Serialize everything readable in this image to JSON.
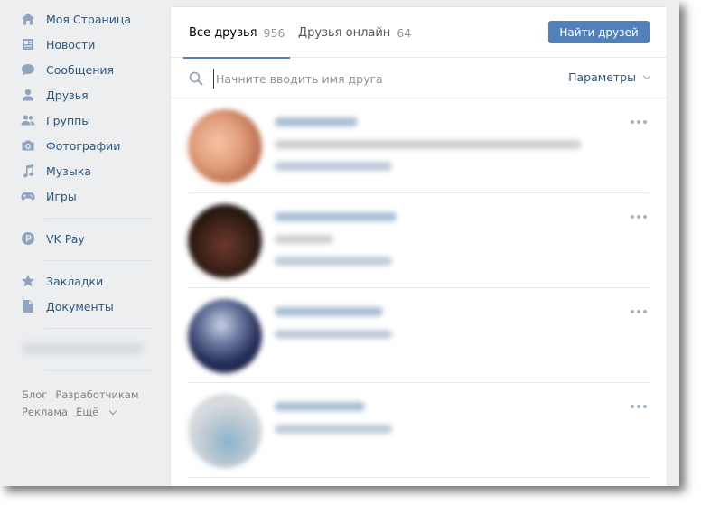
{
  "sidebar": {
    "items": [
      {
        "label": "Моя Страница",
        "icon": "home-icon"
      },
      {
        "label": "Новости",
        "icon": "news-icon"
      },
      {
        "label": "Сообщения",
        "icon": "messages-icon"
      },
      {
        "label": "Друзья",
        "icon": "friends-icon"
      },
      {
        "label": "Группы",
        "icon": "groups-icon"
      },
      {
        "label": "Фотографии",
        "icon": "camera-icon"
      },
      {
        "label": "Музыка",
        "icon": "music-note-icon"
      },
      {
        "label": "Игры",
        "icon": "gamepad-icon"
      },
      {
        "label": "VK Pay",
        "icon": "vkpay-icon"
      },
      {
        "label": "Закладки",
        "icon": "star-icon"
      },
      {
        "label": "Документы",
        "icon": "document-icon"
      }
    ],
    "footer": {
      "blog": "Блог",
      "developers": "Разработчикам",
      "ads": "Реклама",
      "more": "Ещё"
    }
  },
  "tabs": [
    {
      "label": "Все друзья",
      "count": "956",
      "active": true
    },
    {
      "label": "Друзья онлайн",
      "count": "64",
      "active": false
    }
  ],
  "find_friends_label": "Найти друзей",
  "search": {
    "placeholder": "Начните вводить имя друга",
    "params_label": "Параметры"
  },
  "colors": {
    "accent": "#5181b8",
    "link": "#2a5885",
    "background": "#edeef0"
  }
}
